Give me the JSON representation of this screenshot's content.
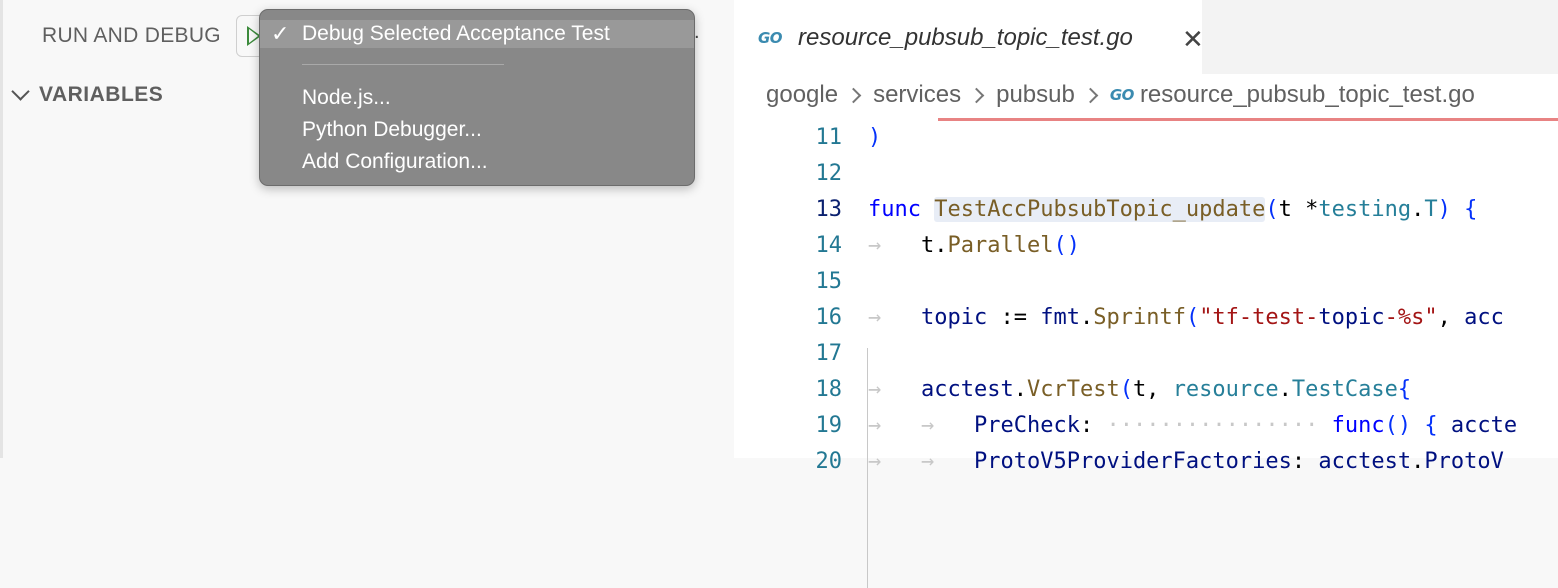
{
  "debug_panel": {
    "title": "RUN AND DEBUG",
    "variables_label": "VARIABLES",
    "more_glyph": "."
  },
  "config_menu": {
    "selected_check": "✓",
    "selected": "Debug Selected Acceptance Test",
    "items": [
      "Node.js...",
      "Python Debugger...",
      "Add Configuration..."
    ]
  },
  "editor": {
    "tab": {
      "filename": "resource_pubsub_topic_test.go",
      "close_glyph": "✕",
      "icon_text": "GO"
    },
    "breadcrumb": [
      "google",
      "services",
      "pubsub",
      "resource_pubsub_topic_test.go"
    ],
    "active_line": 13,
    "lines": [
      {
        "num": "11",
        "text": ")"
      },
      {
        "num": "12",
        "text": ""
      },
      {
        "num": "13",
        "text": "func TestAccPubsubTopic_update(t *testing.T) {"
      },
      {
        "num": "14",
        "text": "t.Parallel()"
      },
      {
        "num": "15",
        "text": ""
      },
      {
        "num": "16",
        "text": "topic := fmt.Sprintf(\"tf-test-topic-%s\", acc"
      },
      {
        "num": "17",
        "text": ""
      },
      {
        "num": "18",
        "text": "acctest.VcrTest(t, resource.TestCase{"
      },
      {
        "num": "19",
        "text": "PreCheck: func() { accte"
      },
      {
        "num": "20",
        "text": "ProtoV5ProviderFactories: acctest.ProtoV"
      }
    ]
  },
  "colors": {
    "keyword": "#0000ff",
    "function": "#795e26",
    "type": "#267f99",
    "string": "#a31515",
    "line_number": "#237893",
    "error_underline": "#e05a5a",
    "menu_bg": "#888888"
  }
}
